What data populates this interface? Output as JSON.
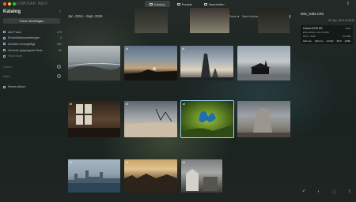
{
  "app": {
    "brand": "LUMINAR NEO",
    "tabs": [
      {
        "label": "Katalog",
        "active": true,
        "icon": "catalog-icon"
      },
      {
        "label": "Presets",
        "active": false,
        "icon": "presets-icon"
      },
      {
        "label": "Bearbeiten",
        "active": false,
        "icon": "edit-icon"
      }
    ],
    "share_icon": "share-icon"
  },
  "sidebar": {
    "title": "Katalog",
    "add_photos": "Fotos hinzufügen",
    "items": [
      {
        "label": "Alle Fotos",
        "count": "473",
        "icon": "photos-icon"
      },
      {
        "label": "Einzelbildbearbeitungen",
        "count": "3",
        "icon": "single-edits-icon"
      },
      {
        "label": "Kürzlich hinzugefügt",
        "count": "300",
        "icon": "recent-icon"
      },
      {
        "label": "Verloren gegangene Bear...",
        "count": "30",
        "icon": "lost-edits-icon"
      },
      {
        "label": "Papierkorb",
        "count": "",
        "icon": "trash-icon"
      }
    ],
    "section_ordner": "Ordner",
    "section_alben": "Alben",
    "album": "Neues Album"
  },
  "main": {
    "date_range": "Jan. 2016 – Sept. 2019",
    "filter_show": "Zeigt: Alle Fotos ▾",
    "filter_sort": "Nach Aufnahmezeit ▾",
    "filter_size": "Mittel ▾"
  },
  "inspector": {
    "filename": "IMG_6465.CR2",
    "date": "09. Sep. 2019 13:03:08",
    "camera": "Canon EOS 6D",
    "raw_badge": "RAW",
    "lens": "EF24-105mm f/4L IS USM",
    "resolution": "5472 × 3648",
    "file_size": "24.9 MB",
    "exif": [
      "102 mm",
      "100 mm",
      "0.0 EV",
      "f/8.0",
      "1/250"
    ]
  }
}
